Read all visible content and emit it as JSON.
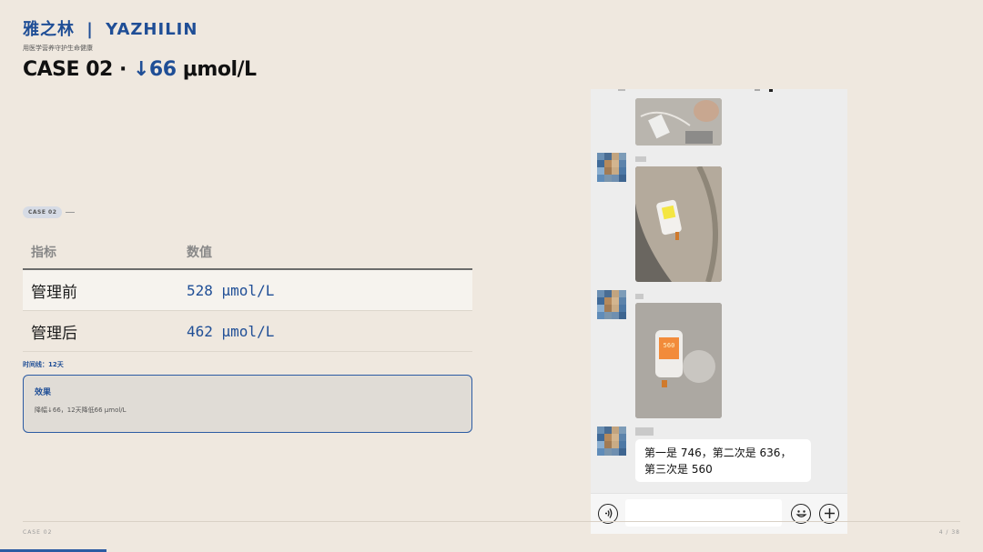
{
  "brand": {
    "cn": "雅之林",
    "sep": "|",
    "en": "YAZHILIN"
  },
  "subtitle": "用医学营养守护生命健康",
  "headline": {
    "prefix": "CASE 02 · ",
    "delta": "↓66",
    "unit": " μmol/L"
  },
  "chip": "CASE 02",
  "table": {
    "headers": [
      "指标",
      "数值"
    ],
    "rows": [
      {
        "label": "管理前",
        "value": "528 μmol/L"
      },
      {
        "label": "管理后",
        "value": "462 μmol/L"
      }
    ]
  },
  "timeline": "时间线：12天",
  "effect": {
    "title": "效果",
    "text": "降幅↓66，12天降低66 μmol/L"
  },
  "footer": {
    "left": "CASE 02",
    "right": "4 / 38",
    "progress": 0.108
  },
  "chat": {
    "message": "第一是 746，第二次是 636，第三次是 560",
    "meter_reading_1": "",
    "meter_reading_2": "560",
    "icons": {
      "voice": "voice-icon",
      "emoji": "emoji-icon",
      "plus": "plus-icon"
    }
  },
  "colors": {
    "accent": "#1f4e96",
    "background": "#efe8df"
  }
}
